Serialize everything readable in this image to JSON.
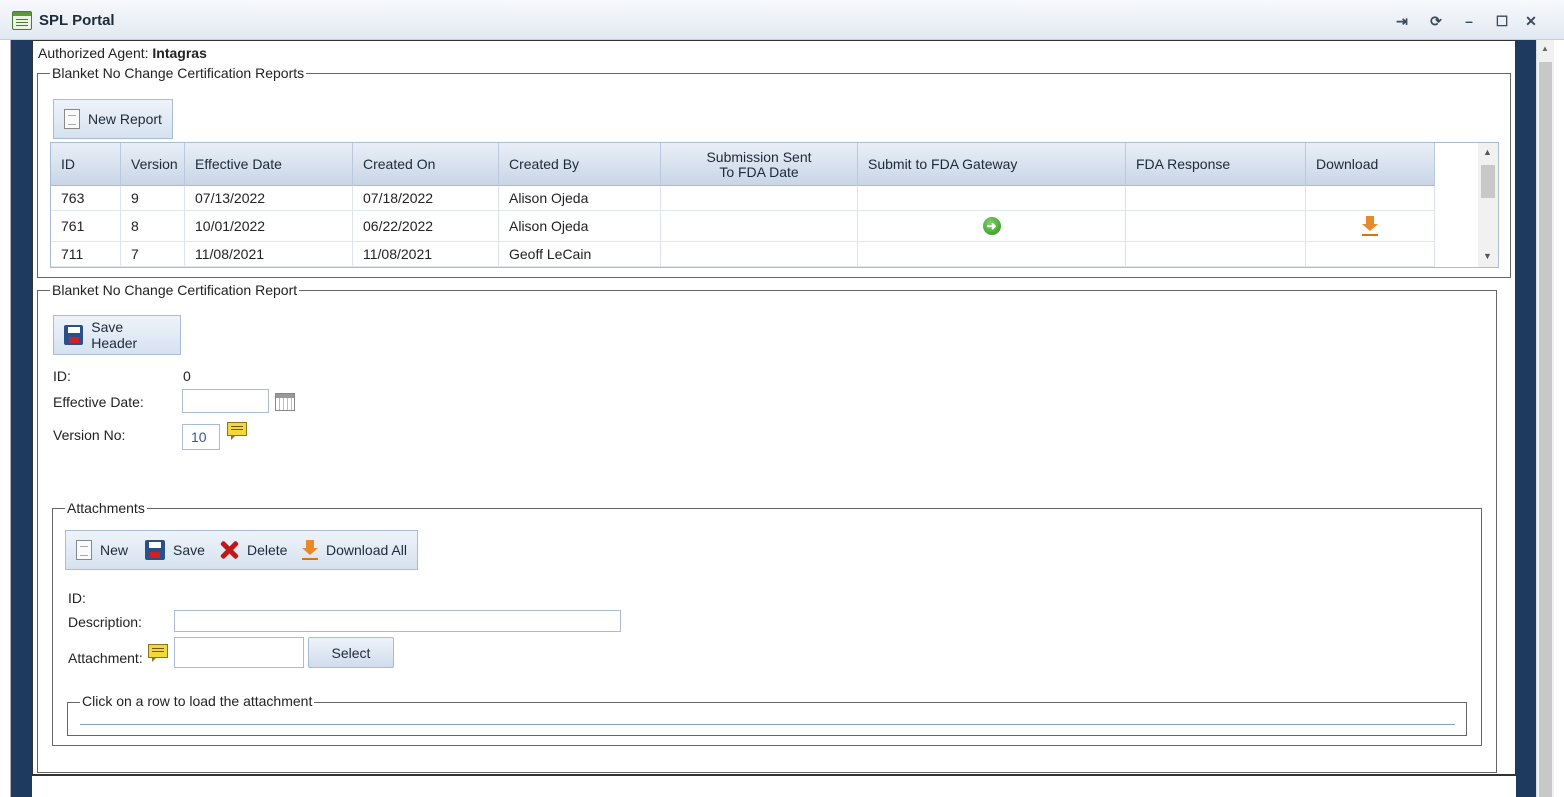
{
  "window": {
    "title": "SPL Portal",
    "icon": "document-icon"
  },
  "agent": {
    "label": "Authorized Agent:",
    "name": "Intagras"
  },
  "reports_section": {
    "legend": "Blanket No Change Certification Reports",
    "new_report_label": "New Report",
    "columns": [
      "ID",
      "Version",
      "Effective Date",
      "Created On",
      "Created By",
      "Submission Sent",
      "To FDA Date",
      "Submit to FDA Gateway",
      "FDA Response",
      "Download"
    ],
    "rows": [
      {
        "id": "763",
        "version": "9",
        "effective": "07/13/2022",
        "created_on": "07/18/2022",
        "created_by": "Alison Ojeda",
        "submission": "",
        "submit": "",
        "response": "",
        "download": ""
      },
      {
        "id": "761",
        "version": "8",
        "effective": "10/01/2022",
        "created_on": "06/22/2022",
        "created_by": "Alison Ojeda",
        "submission": "",
        "submit": "go-icon",
        "response": "",
        "download": "download-icon"
      },
      {
        "id": "711",
        "version": "7",
        "effective": "11/08/2021",
        "created_on": "11/08/2021",
        "created_by": "Geoff LeCain",
        "submission": "",
        "submit": "",
        "response": "",
        "download": ""
      }
    ]
  },
  "report_form": {
    "legend": "Blanket No Change Certification Report",
    "save_header_label": "Save Header",
    "id_label": "ID:",
    "id_value": "0",
    "effective_date_label": "Effective Date:",
    "effective_date_value": "",
    "version_label": "Version No:",
    "version_value": "10"
  },
  "attachments": {
    "legend": "Attachments",
    "toolbar": {
      "new": "New",
      "save": "Save",
      "delete": "Delete",
      "download_all": "Download All"
    },
    "id_label": "ID:",
    "description_label": "Description:",
    "description_value": "",
    "attachment_label": "Attachment:",
    "attachment_value": "",
    "select_label": "Select",
    "hint_legend": "Click on a row to load the attachment"
  }
}
